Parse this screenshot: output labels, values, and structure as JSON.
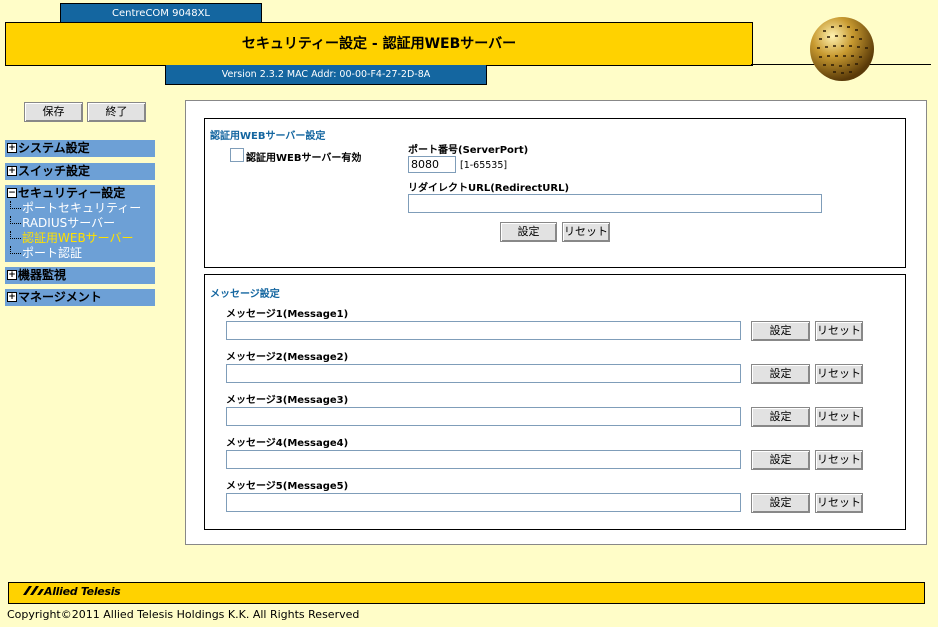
{
  "header": {
    "model": "CentreCOM 9048XL",
    "title": "セキュリティー設定 - 認証用WEBサーバー",
    "version": "Version 2.3.2 MAC Addr: 00-00-F4-27-2D-8A"
  },
  "toolbar": {
    "save_label": "保存",
    "exit_label": "終了"
  },
  "sidebar": {
    "system": "システム設定",
    "switch": "スイッチ設定",
    "security": "セキュリティー設定",
    "security_items": [
      "ポートセキュリティー",
      "RADIUSサーバー",
      "認証用WEBサーバー",
      "ポート認証"
    ],
    "monitor": "機器監視",
    "management": "マネージメント",
    "plus": "+",
    "minus": "−"
  },
  "web_server": {
    "section_title": "認証用WEBサーバー設定",
    "enable_label": "認証用WEBサーバー有効",
    "port_label": "ポート番号(ServerPort)",
    "port_value": "8080",
    "port_range": "[1-65535]",
    "redirect_label": "リダイレクトURL(RedirectURL)",
    "redirect_value": "",
    "set_label": "設定",
    "reset_label": "リセット"
  },
  "messages": {
    "section_title": "メッセージ設定",
    "items": [
      {
        "label": "メッセージ1(Message1)",
        "value": ""
      },
      {
        "label": "メッセージ2(Message2)",
        "value": ""
      },
      {
        "label": "メッセージ3(Message3)",
        "value": ""
      },
      {
        "label": "メッセージ4(Message4)",
        "value": ""
      },
      {
        "label": "メッセージ5(Message5)",
        "value": ""
      }
    ],
    "set_label": "設定",
    "reset_label": "リセット"
  },
  "footer": {
    "logo_text": "Allied Telesis",
    "copyright": "Copyright©2011 Allied Telesis Holdings K.K. All Rights Reserved"
  },
  "colors": {
    "yellow": "#FFD200",
    "blue": "#1466A0",
    "menu": "#6DA0D6",
    "bg": "#FFFDC8"
  }
}
